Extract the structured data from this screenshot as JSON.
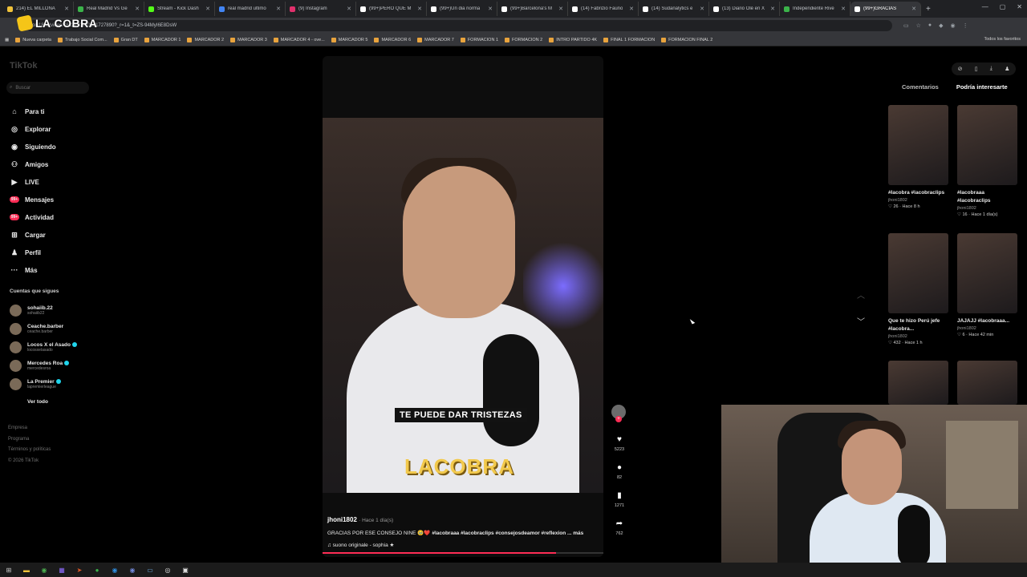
{
  "browser": {
    "tabs": [
      {
        "title": "214) EL MILLONA",
        "color": "#f0c23a"
      },
      {
        "title": "Real Madrid Vs Ge",
        "color": "#3bb34a"
      },
      {
        "title": "Stream - Kick Dash",
        "color": "#53fc18"
      },
      {
        "title": "real madrid ultimo",
        "color": "#4285f4"
      },
      {
        "title": "(9) Instagram",
        "color": "#e1306c"
      },
      {
        "title": "(99+)PERO QUE M",
        "color": "#ffffff"
      },
      {
        "title": "(99+)Un dia norma",
        "color": "#ffffff"
      },
      {
        "title": "(99+)Barcelona's M",
        "color": "#ffffff"
      },
      {
        "title": "(14) Fabrizio Fauno",
        "color": "#ffffff"
      },
      {
        "title": "(14) Sudanalytics e",
        "color": "#ffffff"
      },
      {
        "title": "(13) Diario Olé en X",
        "color": "#ffffff"
      },
      {
        "title": "Independiente Rive",
        "color": "#3bb34a"
      },
      {
        "title": "(99+)GRACIAS",
        "color": "#ffffff"
      }
    ],
    "address": "oni1802/video/7612470970191727890?_r=1&_t=ZS-94MyI6E8DsW",
    "bookmarks": [
      "Nueva carpeta",
      "Trabajo Social Com...",
      "Gran DT",
      "MARCADOR 1",
      "MARCADOR 2",
      "MARCADOR 3",
      "MARCADOR 4 - ove...",
      "MARCADOR 5",
      "MARCADOR 6",
      "MARCADOR 7",
      "FORMACION 1",
      "FORMACION 2",
      "INTRO PARTIDO 4K",
      "FINAL 1 FORMACION",
      "FORMACION FINAL 2"
    ],
    "bookmarks_right": "Todos los favoritos"
  },
  "overlay_logo": "LA COBRA",
  "sidebar": {
    "logo": "TikTok",
    "search_placeholder": "Buscar",
    "nav": [
      {
        "label": "Para ti",
        "icon": "home-icon"
      },
      {
        "label": "Explorar",
        "icon": "compass-icon"
      },
      {
        "label": "Siguiendo",
        "icon": "following-icon"
      },
      {
        "label": "Amigos",
        "icon": "friends-icon"
      },
      {
        "label": "LIVE",
        "icon": "live-icon"
      },
      {
        "label": "Mensajes",
        "icon": "messages-icon",
        "badge": "99+"
      },
      {
        "label": "Actividad",
        "icon": "activity-icon",
        "badge": "99+"
      },
      {
        "label": "Cargar",
        "icon": "upload-icon"
      },
      {
        "label": "Perfil",
        "icon": "profile-icon"
      },
      {
        "label": "Más",
        "icon": "more-icon"
      }
    ],
    "following_title": "Cuentas que sigues",
    "following": [
      {
        "name": "sohaiib.22",
        "handle": "sohaiib22",
        "verified": false
      },
      {
        "name": "Ceache.barber",
        "handle": "ceache.barber",
        "verified": false
      },
      {
        "name": "Locos X el Asado",
        "handle": "locosxelasado",
        "verified": true
      },
      {
        "name": "Mercedes Roa",
        "handle": "mercedesroa",
        "verified": true
      },
      {
        "name": "La Premier",
        "handle": "lapremierleague",
        "verified": true
      }
    ],
    "see_all": "Ver todo",
    "footer": [
      "Empresa",
      "Programa",
      "Términos y políticas",
      "© 2026 TikTok"
    ]
  },
  "video": {
    "caption_overlay": "TE PUEDE DAR TRISTEZAS",
    "watermark": "LACOBRA",
    "author": "jhoni1802",
    "when": "· Hace 1 día(s)",
    "desc_text": "GRACIAS POR ESE CONSEJO NINE 🥹❤️ ",
    "desc_tags": "#lacobraaa #lacobraclips #consejosdeamor #reflexion ...",
    "desc_more": "más",
    "sound": "♫  suono originale - sophia ★",
    "progress": 0.83,
    "actions": {
      "likes": "5223",
      "comments": "82",
      "saves": "1271",
      "shares": "762"
    }
  },
  "right_panel": {
    "tabs": [
      "Comentarios",
      "Podría interesarte"
    ],
    "active_tab": 1,
    "items": [
      {
        "title": "#lacobra #lacobraclips",
        "user": "jhoni1802",
        "likes": "26",
        "time": "Hace 8 h"
      },
      {
        "title": "#lacobraaa #lacobraclips",
        "user": "jhoni1802",
        "likes": "16",
        "time": "Hace 1 día(s)"
      },
      {
        "title": "Que te hizo Perú jefe #lacobra...",
        "user": "jhoni1802",
        "likes": "432",
        "time": "Hace 1 h"
      },
      {
        "title": "JAJAJJ #lacobraaa...",
        "user": "jhoni1802",
        "likes": "6",
        "time": "Hace 42 min"
      },
      {
        "title": "",
        "user": "",
        "likes": "",
        "time": ""
      },
      {
        "title": "",
        "user": "",
        "likes": "",
        "time": ""
      }
    ]
  }
}
